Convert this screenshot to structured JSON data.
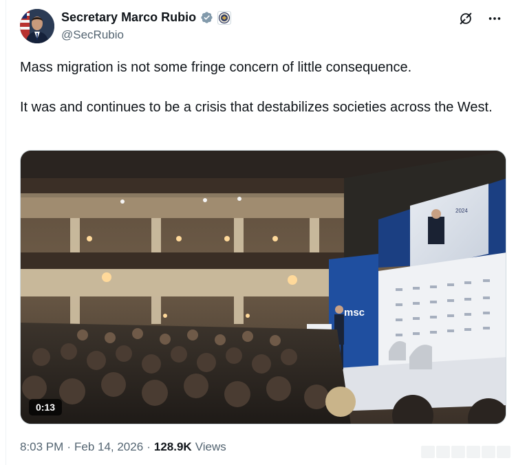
{
  "author": {
    "display_name": "Secretary Marco Rubio",
    "handle": "@SecRubio",
    "avatar_icon": "profile-photo",
    "verified_icon": "gray-verified-badge-icon",
    "affiliation_icon": "state-department-seal-icon"
  },
  "actions": {
    "grok_icon": "grok-icon",
    "more_icon": "more-options-icon"
  },
  "tweet": {
    "paragraph_1": "Mass migration is not some fringe concern of little consequence.",
    "paragraph_2": "It was and continues to be a crisis that destabilizes societies across the West."
  },
  "media": {
    "type": "video",
    "duration": "0:13",
    "stage_logo": "msc",
    "screen_label": "2024"
  },
  "meta": {
    "time": "8:03 PM",
    "separator_1": "·",
    "date": "Feb 14, 2026",
    "separator_2": "·",
    "views_count": "128.9K",
    "views_label": "Views"
  },
  "colors": {
    "text_primary": "#0f1419",
    "text_secondary": "#536471",
    "verified_gray": "#829aab",
    "border": "#cfd9de",
    "stage_blue": "#1f4fa0"
  }
}
